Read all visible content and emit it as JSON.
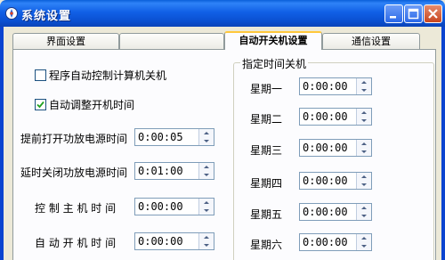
{
  "window": {
    "title": "系统设置"
  },
  "tabs": [
    {
      "label": "界面设置"
    },
    {
      "label": ""
    },
    {
      "label": "自动开关机设置"
    },
    {
      "label": "通信设置"
    }
  ],
  "options": {
    "auto_shutdown": {
      "label": "程序自动控制计算机关机",
      "checked": false
    },
    "auto_poweron": {
      "label": "自动调整开机时间",
      "checked": true
    }
  },
  "fields": [
    {
      "label": "提前打开功放电源时间",
      "value": "0:00:05"
    },
    {
      "label": "延时关闭功放电源时间",
      "value": "0:01:00"
    },
    {
      "label": "控 制 主 机 时 间",
      "value": "0:00:00"
    },
    {
      "label": "自 动 开 机 时 间",
      "value": "0:00:00"
    }
  ],
  "schedule": {
    "title": "指定时间关机",
    "days": [
      {
        "label": "星期一",
        "value": "0:00:00"
      },
      {
        "label": "星期二",
        "value": "0:00:00"
      },
      {
        "label": "星期三",
        "value": "0:00:00"
      },
      {
        "label": "星期四",
        "value": "0:00:00"
      },
      {
        "label": "星期五",
        "value": "0:00:00"
      },
      {
        "label": "星期六",
        "value": "0:00:00"
      }
    ]
  },
  "icons": {
    "app": "gear-app-icon",
    "minimize": "minimize-icon",
    "maximize": "maximize-icon",
    "close": "close-icon",
    "spin": "spin-arrows-icon",
    "check": "check-icon"
  },
  "colors": {
    "titlebar": "#0a4fd0",
    "close_button": "#c8451f",
    "tab_highlight": "#ffc83c"
  }
}
